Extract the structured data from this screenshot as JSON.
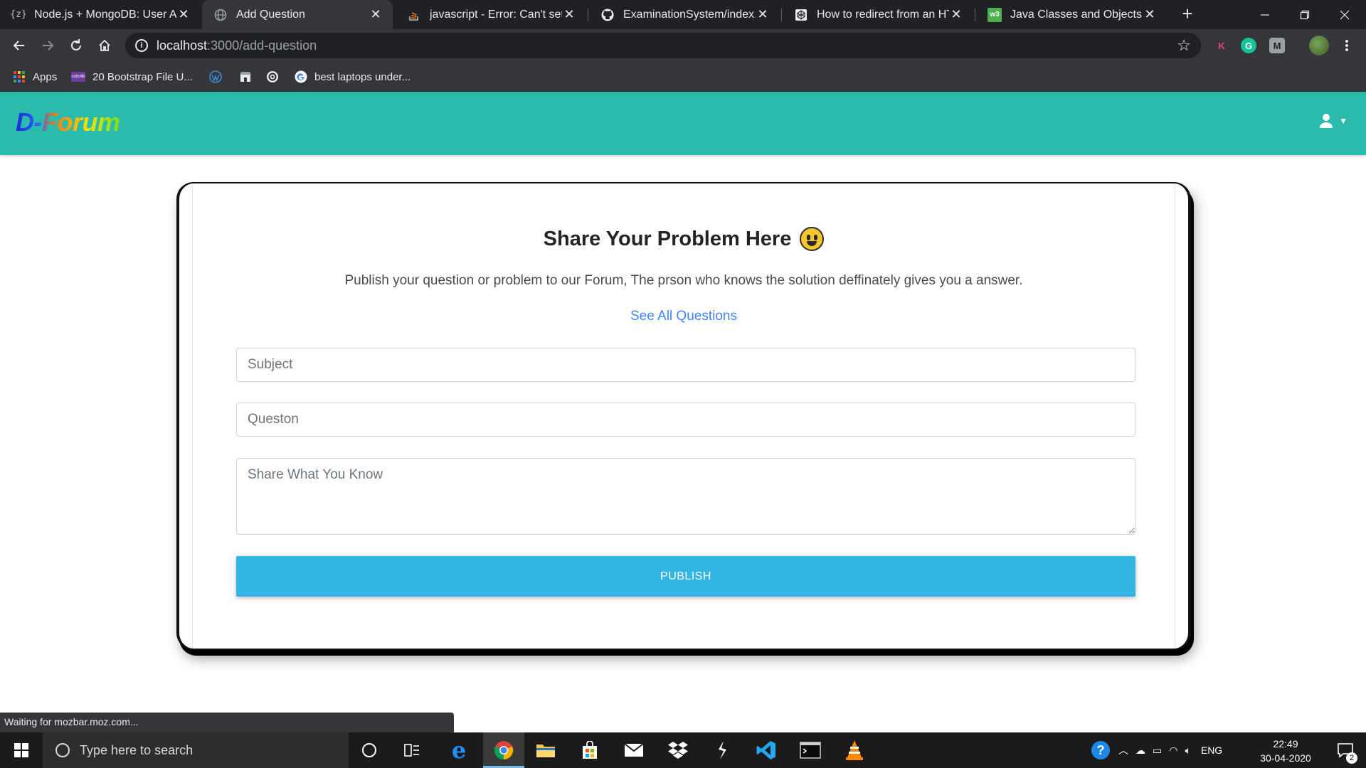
{
  "browser": {
    "tabs": [
      {
        "title": "Node.js + MongoDB: User Au",
        "icon": "code-braces-icon",
        "active": false
      },
      {
        "title": "Add Question",
        "icon": "globe-icon",
        "active": true
      },
      {
        "title": "javascript - Error: Can't set he",
        "icon": "stackoverflow-icon",
        "active": false
      },
      {
        "title": "ExaminationSystem/index.js",
        "icon": "github-icon",
        "active": false
      },
      {
        "title": "How to redirect from an HTM",
        "icon": "codepen-icon",
        "active": false
      },
      {
        "title": "Java Classes and Objects",
        "icon": "w3schools-icon",
        "active": false
      }
    ],
    "url_host": "localhost",
    "url_path": ":3000/add-question",
    "bookmarks": [
      {
        "label": "Apps",
        "icon": "apps-grid-icon"
      },
      {
        "label": "20 Bootstrap File U...",
        "icon": "colorlib-icon"
      },
      {
        "label": "",
        "icon": "wordpress-icon"
      },
      {
        "label": "",
        "icon": "store-icon"
      },
      {
        "label": "",
        "icon": "circle-logo-icon"
      },
      {
        "label": "best laptops under...",
        "icon": "google-icon"
      }
    ],
    "extensions": [
      "K",
      "G",
      "M"
    ],
    "status": "Waiting for mozbar.moz.com..."
  },
  "site": {
    "brand": "D-Forum",
    "colors": {
      "navbar": "#2bbbad",
      "publish": "#33b5e5",
      "link": "#4285f4"
    }
  },
  "card": {
    "title": "Share Your Problem Here",
    "lead": "Publish your question or problem to our Forum, The prson who knows the solution deffinately gives you a answer.",
    "link": "See All Questions",
    "subject_placeholder": "Subject",
    "question_placeholder": "Queston",
    "body_placeholder": "Share What You Know",
    "publish_label": "PUBLISH"
  },
  "taskbar": {
    "search_placeholder": "Type here to search",
    "apps": [
      "task-view-icon",
      "cortana-icon",
      "edge-icon",
      "chrome-icon",
      "file-explorer-icon",
      "store-icon",
      "mail-icon",
      "dropbox-icon",
      "sublime-icon",
      "vscode-icon",
      "terminal-icon",
      "vlc-icon"
    ],
    "language": "ENG",
    "time": "22:49",
    "date": "30-04-2020",
    "notifications": "2"
  }
}
